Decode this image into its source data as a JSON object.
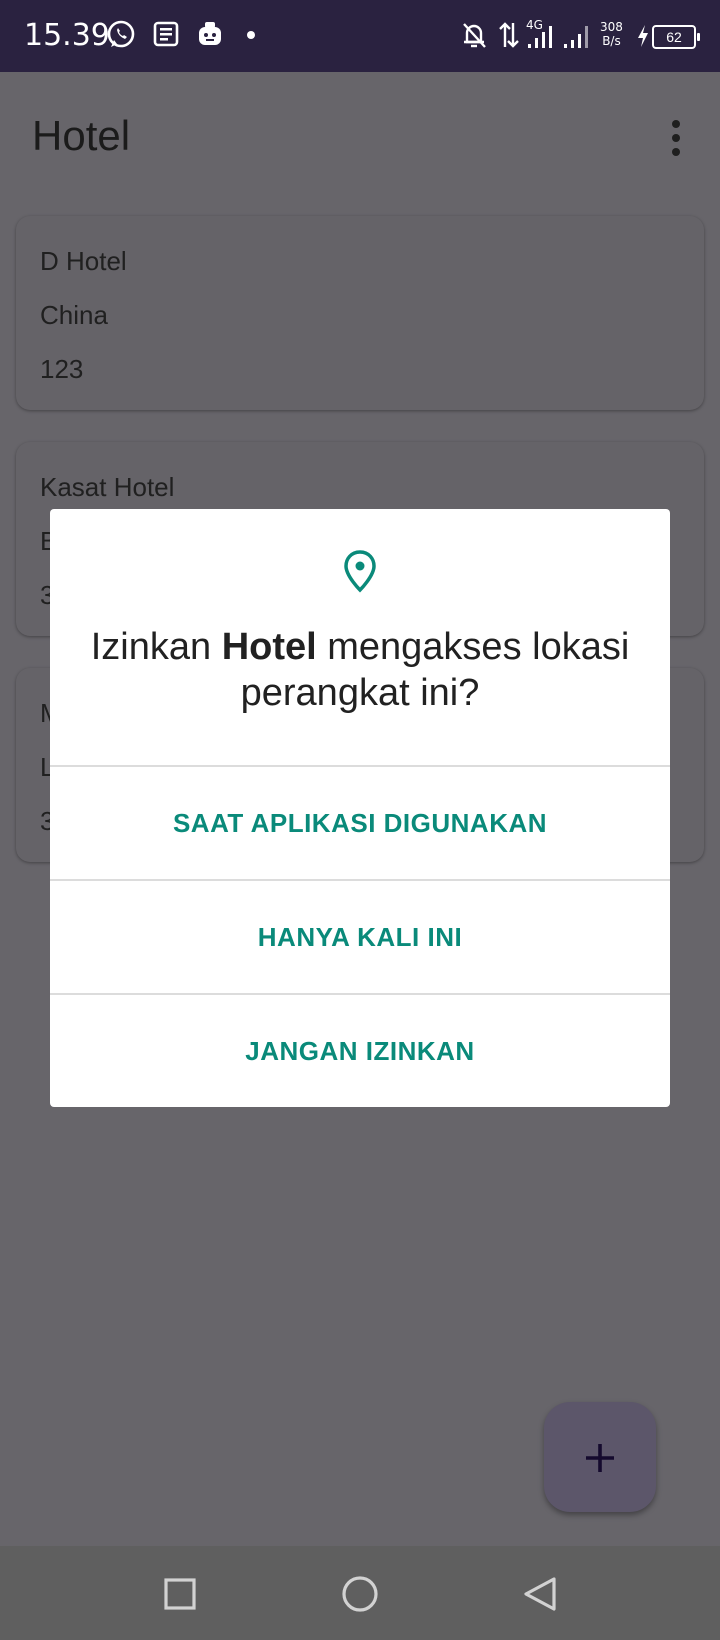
{
  "status_bar": {
    "time": "15.39",
    "network_type": "4G",
    "net_speed_value": "308",
    "net_speed_unit": "B/s",
    "battery": "62",
    "icons": [
      "whatsapp-icon",
      "news-icon",
      "bot-icon",
      "dot-icon",
      "bell-off-icon",
      "data-arrows-icon",
      "signal-icon",
      "signal-icon",
      "charging-icon",
      "battery-icon"
    ]
  },
  "app_bar": {
    "title": "Hotel",
    "menu_icon": "more-vert-icon"
  },
  "hotels": [
    {
      "name": "D Hotel",
      "location": "China",
      "number": "123"
    },
    {
      "name": "Kasat Hotel",
      "location": "B",
      "number": "3"
    },
    {
      "name": "M",
      "location": "L",
      "number": "3"
    }
  ],
  "dialog": {
    "icon": "location-pin-icon",
    "title_prefix": "Izinkan ",
    "title_app": "Hotel",
    "title_suffix": " mengakses lokasi perangkat ini?",
    "buttons": {
      "while_using": "SAAT APLIKASI DIGUNAKAN",
      "only_this_time": "HANYA KALI INI",
      "deny": "JANGAN IZINKAN"
    },
    "accent_color": "#0a8a7a"
  },
  "fab": {
    "icon": "plus-icon"
  },
  "nav_bar": {
    "icons": [
      "recents-square-icon",
      "home-circle-icon",
      "back-triangle-icon"
    ]
  }
}
